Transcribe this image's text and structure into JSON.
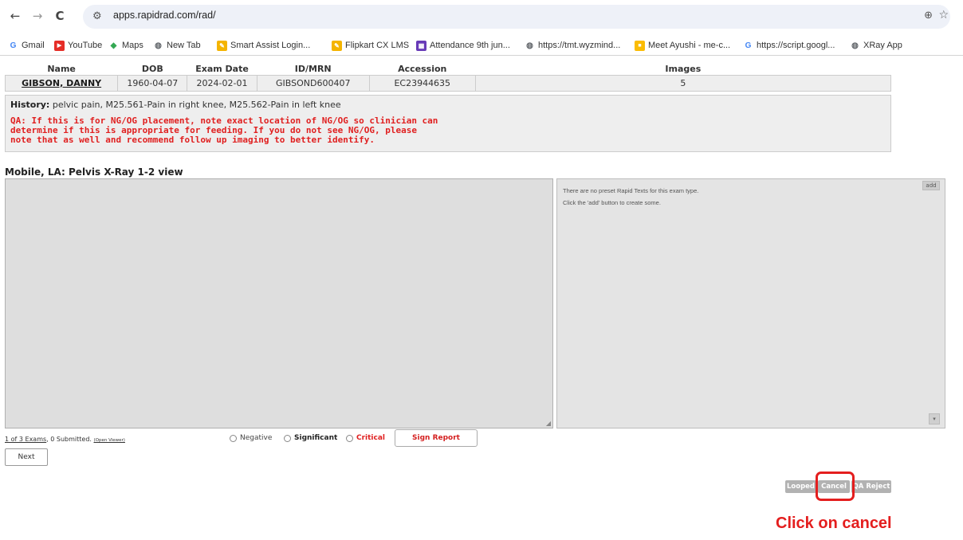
{
  "browser": {
    "url": "apps.rapidrad.com/rad/",
    "back_icon": "←",
    "forward_icon": "→",
    "reload_icon": "C",
    "site_info_icon": "⚙",
    "zoom_icon": "⊕",
    "star_icon": "☆",
    "bookmarks": [
      {
        "label": "Gmail",
        "icon": "G",
        "color": "#4285f4"
      },
      {
        "label": "YouTube",
        "icon": "▶",
        "color": "#e52d27"
      },
      {
        "label": "Maps",
        "icon": "◆",
        "color": "#34a853"
      },
      {
        "label": "New Tab",
        "icon": "◍",
        "color": "#5f6368"
      },
      {
        "label": "Smart Assist Login...",
        "icon": "✎",
        "color": "#f4b400"
      },
      {
        "label": "Flipkart CX LMS",
        "icon": "✎",
        "color": "#f4b400"
      },
      {
        "label": "Attendance 9th jun...",
        "icon": "▦",
        "color": "#673ab7"
      },
      {
        "label": "https://tmt.wyzmind...",
        "icon": "◍",
        "color": "#5f6368"
      },
      {
        "label": "Meet Ayushi - me-c...",
        "icon": "■",
        "color": "#fbbc04"
      },
      {
        "label": "https://script.googl...",
        "icon": "G",
        "color": "#4285f4"
      },
      {
        "label": "XRay App",
        "icon": "◍",
        "color": "#5f6368"
      }
    ]
  },
  "patient": {
    "headers": [
      "Name",
      "DOB",
      "Exam Date",
      "ID/MRN",
      "Accession",
      "Images"
    ],
    "name": "GIBSON, DANNY",
    "dob": "1960-04-07",
    "exam_date": "2024-02-01",
    "mrn": "GIBSOND600407",
    "accession": "EC23944635",
    "images": "5"
  },
  "history": {
    "label": "History:",
    "text": "pelvic pain, M25.561-Pain in right knee, M25.562-Pain in left knee",
    "qa_note": "QA: If this is for NG/OG placement, note exact location of NG/OG so clinician can determine if this is appropriate for feeding. If you do not see NG/OG, please note that as well and recommend follow up imaging to better identify."
  },
  "exam": {
    "title": "Mobile, LA: Pelvis X-Ray 1-2 view",
    "report_text": ""
  },
  "rapid_texts": {
    "message_line1": "There are no preset Rapid Texts for this exam type.",
    "message_line2": "Click the 'add' button to create some.",
    "add_label": "add",
    "scroll_label": "▾"
  },
  "footer": {
    "exam_count_link": "1 of 3 Exams",
    "exam_count_rest": ", 0 Submitted.",
    "open_viewer": "(Open Viewer)",
    "negative": "Negative",
    "significant": "Significant",
    "critical": "Critical",
    "sign_report": "Sign Report",
    "next": "Next",
    "looped": "Looped",
    "cancel": "Cancel",
    "qa_reject": "QA Reject"
  },
  "annotation": {
    "text": "Click on cancel",
    "color": "#e41e1e"
  }
}
